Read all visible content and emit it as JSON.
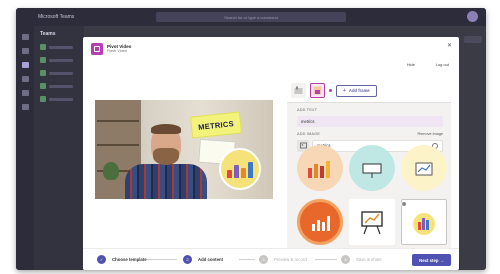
{
  "teams": {
    "title": "Microsoft Teams",
    "search_placeholder": "Search for or type a command",
    "channels_title": "Teams",
    "right_chip": "Meet"
  },
  "modal": {
    "app_name": "Pivot Video",
    "app_subtitle": "Flash Video",
    "hide_label": "Hide",
    "logout_label": "Log out",
    "close_icon": "close-icon"
  },
  "video": {
    "sticker_text": "METRICS"
  },
  "panel": {
    "add_frame_label": "Add frame",
    "add_text_label": "ADD TEXT",
    "text_value": "metrics",
    "add_image_label": "ADD IMAGE",
    "remove_image_label": "Remove image",
    "search_value": "metrics"
  },
  "stepper": {
    "steps": [
      {
        "label": "Choose template",
        "state": "done"
      },
      {
        "label": "Add content",
        "state": "current"
      },
      {
        "label": "Preview & record",
        "state": "upcoming"
      },
      {
        "label": "Save & share",
        "state": "upcoming"
      }
    ],
    "next_label": "Next step →"
  },
  "colors": {
    "accent": "#4f52b2",
    "brand": "#b43fb0",
    "sticker": "#f3f27a"
  }
}
